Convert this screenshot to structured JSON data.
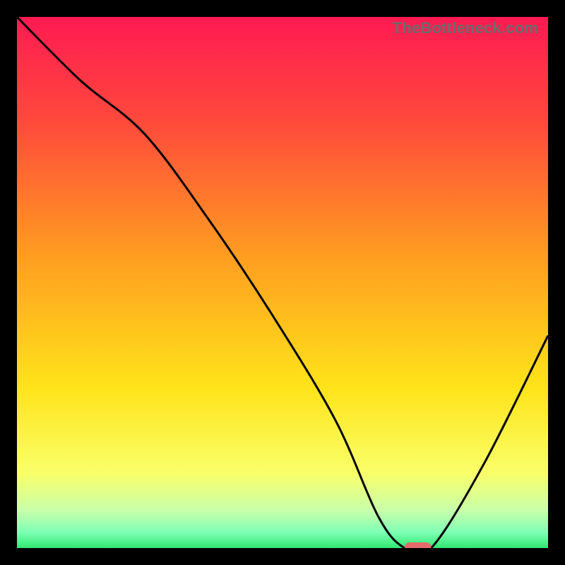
{
  "watermark": "TheBottleneck.com",
  "chart_data": {
    "type": "line",
    "title": "",
    "xlabel": "",
    "ylabel": "",
    "xlim": [
      0,
      100
    ],
    "ylim": [
      0,
      100
    ],
    "grid": false,
    "legend": false,
    "gradient_stops": [
      {
        "offset": 0,
        "color": "#ff1a52"
      },
      {
        "offset": 0.2,
        "color": "#ff4a3c"
      },
      {
        "offset": 0.45,
        "color": "#ff9d20"
      },
      {
        "offset": 0.7,
        "color": "#ffe41a"
      },
      {
        "offset": 0.86,
        "color": "#f9ff6a"
      },
      {
        "offset": 0.93,
        "color": "#c8ffab"
      },
      {
        "offset": 0.97,
        "color": "#7fffb4"
      },
      {
        "offset": 1.0,
        "color": "#30e873"
      }
    ],
    "series": [
      {
        "name": "bottleneck-curve",
        "x": [
          0,
          12,
          24,
          36,
          48,
          60,
          68,
          73,
          78,
          88,
          100
        ],
        "y": [
          100,
          88,
          78,
          62,
          44,
          24,
          6,
          0,
          0,
          16,
          40
        ]
      }
    ],
    "marker": {
      "name": "optimal-range",
      "x_center": 75.5,
      "y": 0,
      "width": 5,
      "color": "#e56a6a"
    }
  }
}
